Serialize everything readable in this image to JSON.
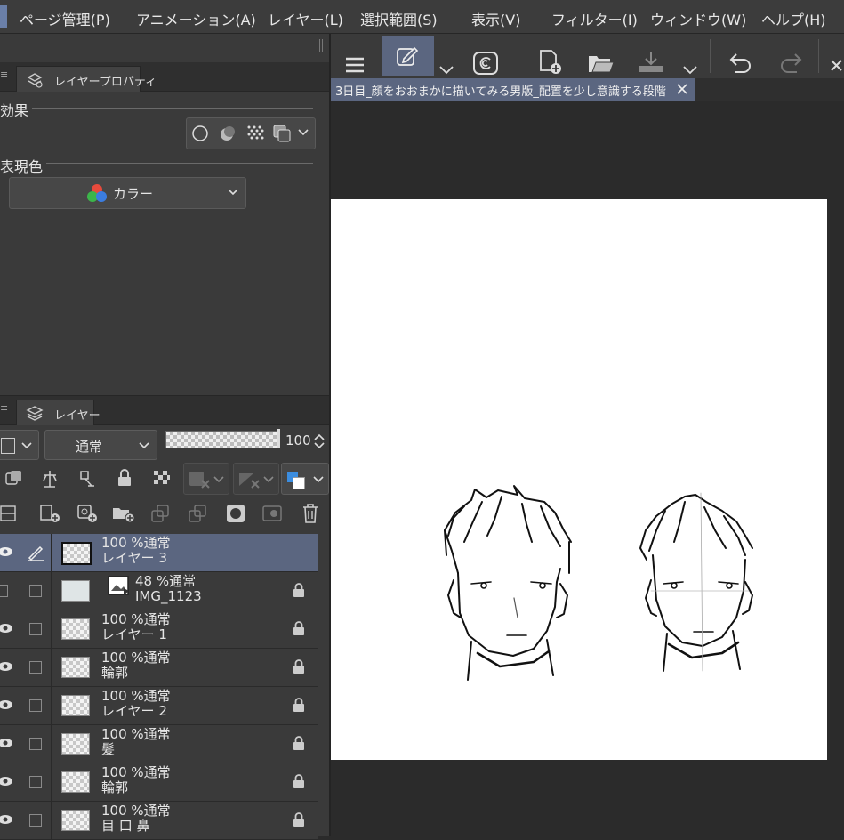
{
  "menu": {
    "items": [
      "ページ管理(P)",
      "アニメーション(A)",
      "レイヤー(L)",
      "選択範囲(S)",
      "表示(V)",
      "フィルター(I)",
      "ウィンドウ(W)",
      "ヘルプ(H)"
    ]
  },
  "property_panel": {
    "tab_label": "レイヤープロパティ",
    "effect_label": "効果",
    "expression_color_label": "表現色",
    "expression_color_value": "カラー"
  },
  "layer_panel": {
    "tab_label": "レイヤー",
    "blend_mode": "通常",
    "opacity_value": "100",
    "layers": [
      {
        "top": "100 %通常",
        "name": "レイヤー 3",
        "selected": true
      },
      {
        "top": "48 %通常",
        "name": "IMG_1123",
        "selected": false
      },
      {
        "top": "100 %通常",
        "name": "レイヤー 1",
        "selected": false
      },
      {
        "top": "100 %通常",
        "name": "輪郭",
        "selected": false
      },
      {
        "top": "100 %通常",
        "name": "レイヤー 2",
        "selected": false
      },
      {
        "top": "100 %通常",
        "name": "髪",
        "selected": false
      },
      {
        "top": "100 %通常",
        "name": "輪郭",
        "selected": false
      },
      {
        "top": "100 %通常",
        "name": "目 口 鼻",
        "selected": false
      }
    ]
  },
  "document": {
    "tab_title": "3日目_顔をおおまかに描いてみる男版_配置を少し意識する段階"
  },
  "colors": {
    "selected_row": "#5b6680",
    "accent_blue": "#3b8de0",
    "panel_bg": "#3a3a3a"
  }
}
